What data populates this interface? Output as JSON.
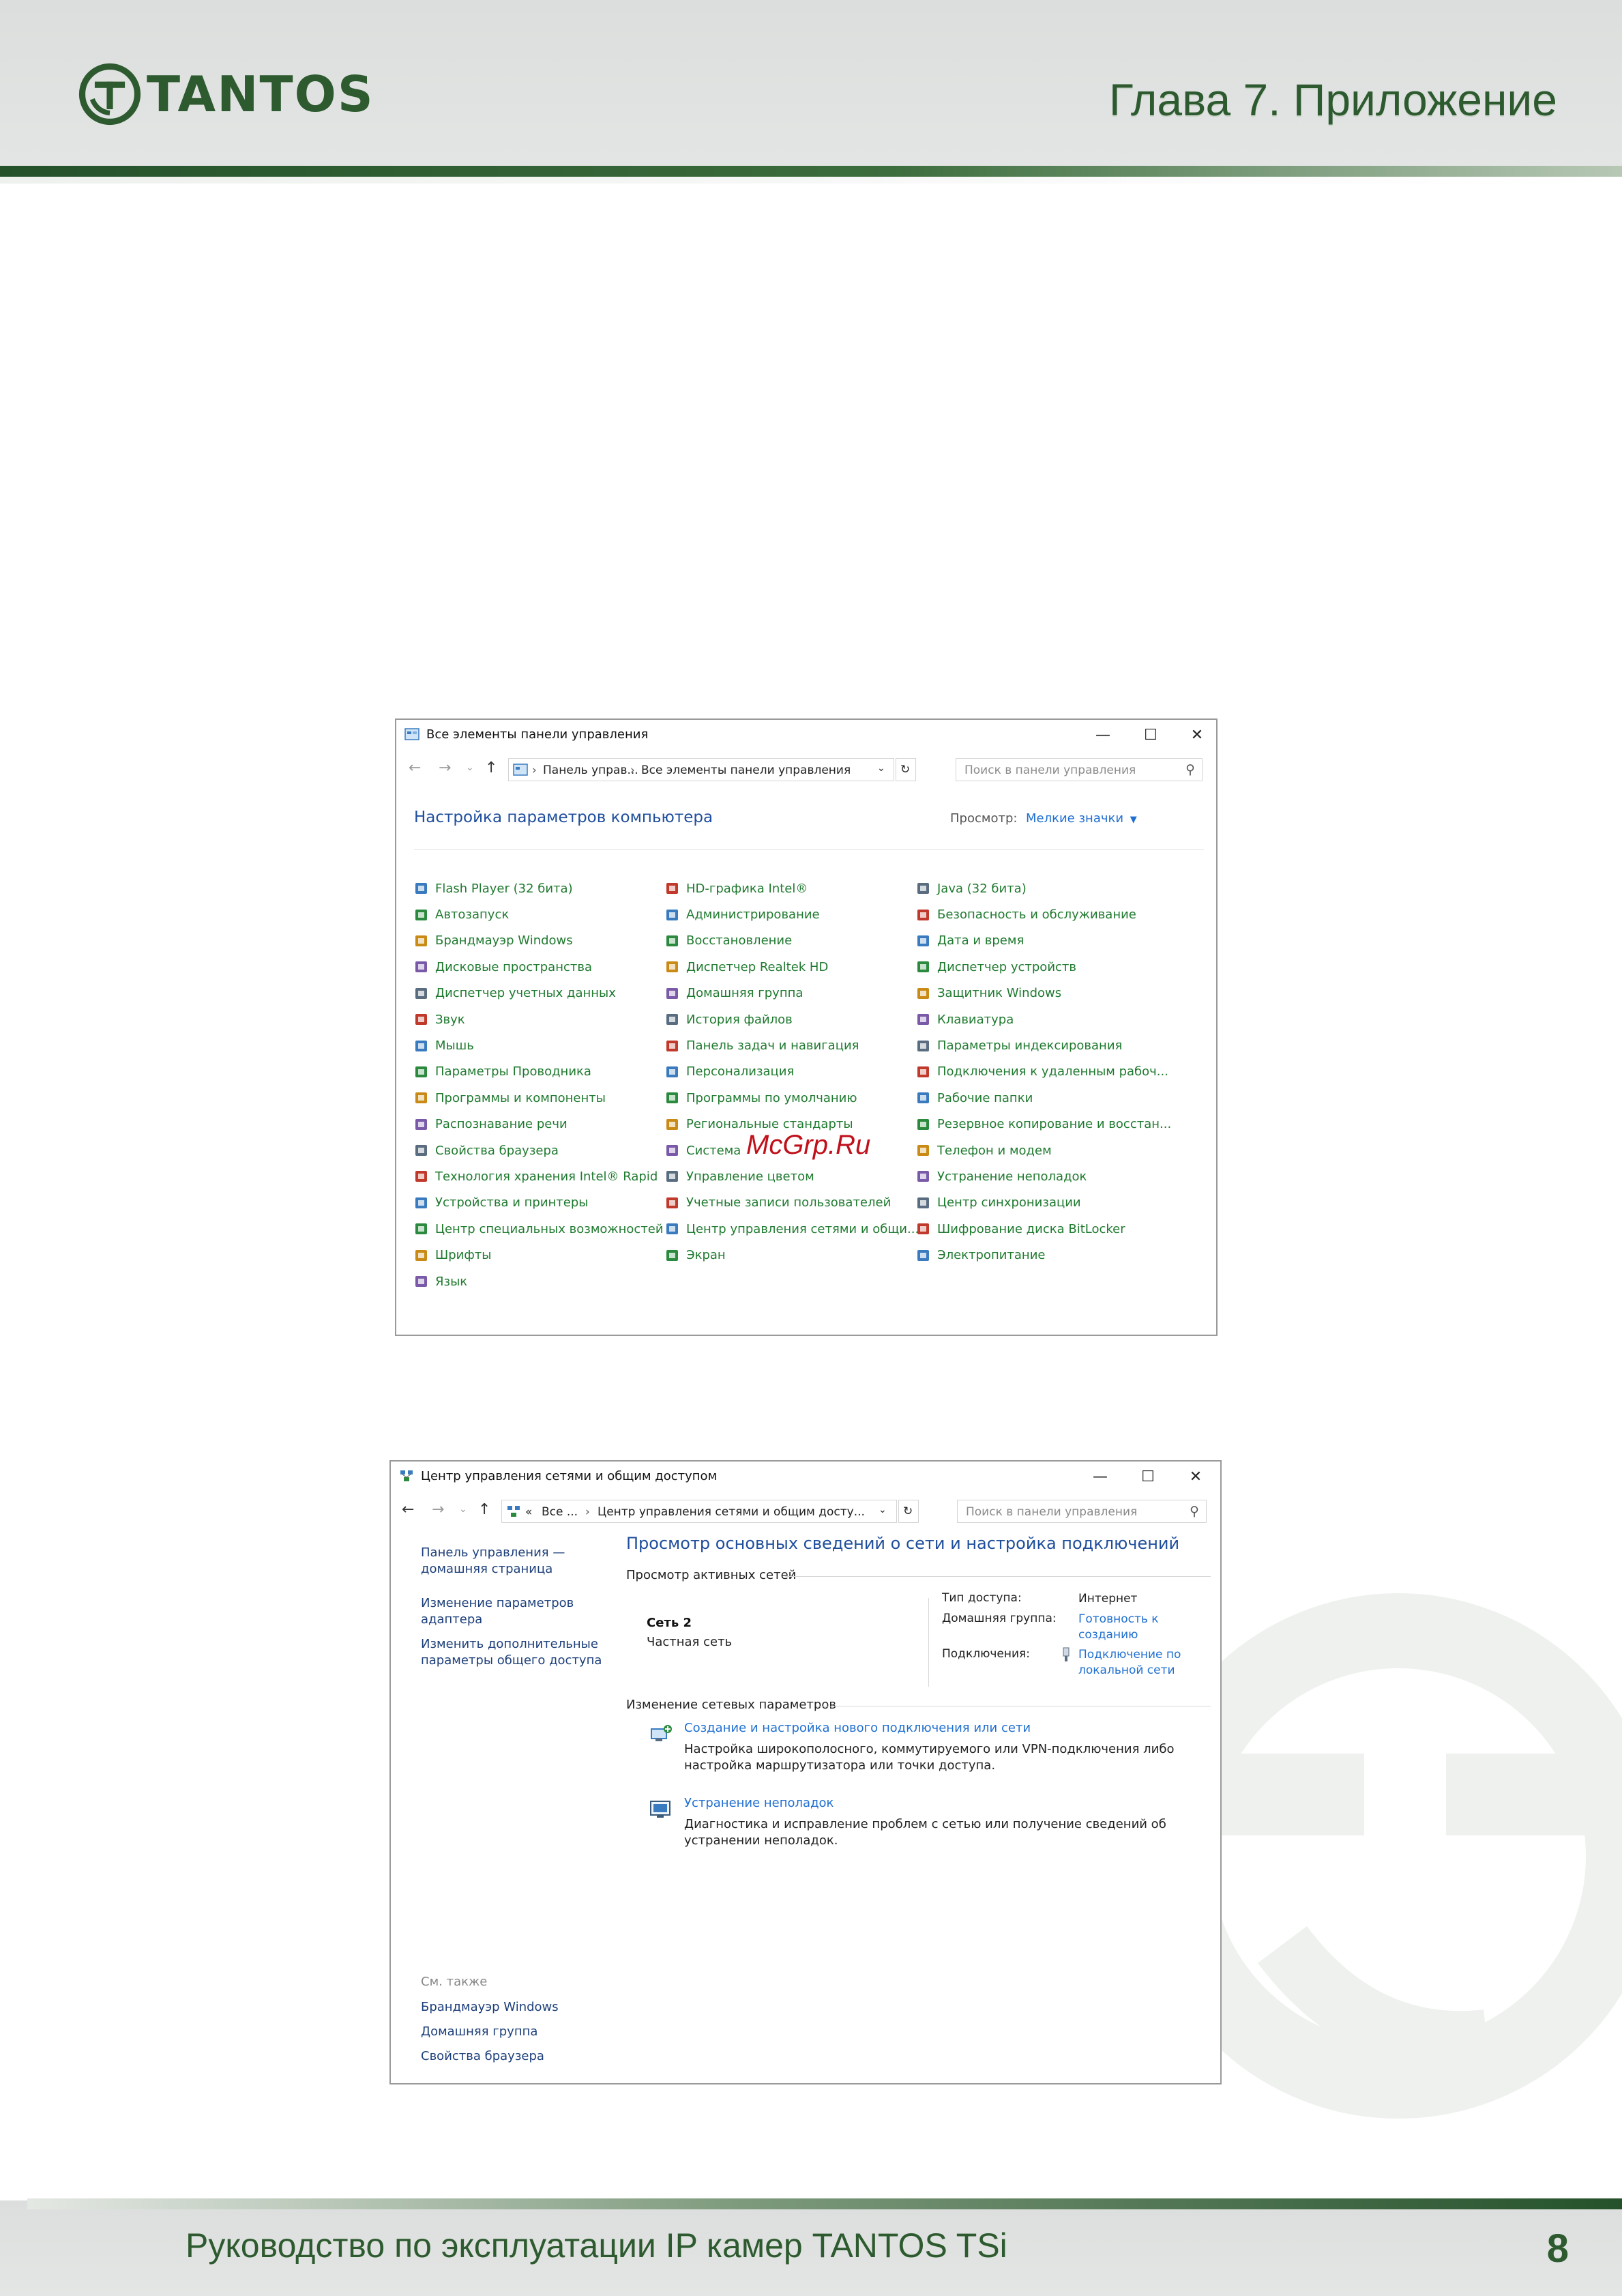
{
  "header": {
    "logo_text": "TANTOS",
    "chapter": "Глава 7. Приложение"
  },
  "footer": {
    "title": "Руководство по эксплуатации IP камер TANTOS TSi",
    "page": "8"
  },
  "watermark": "McGrp.Ru",
  "window1": {
    "title": "Все элементы панели управления",
    "breadcrumb": [
      "Панель управ...",
      "Все элементы панели управления"
    ],
    "search_placeholder": "Поиск в панели управления",
    "heading": "Настройка параметров компьютера",
    "view_label": "Просмотр:",
    "view_value": "Мелкие значки",
    "columns": [
      [
        {
          "label": "Flash Player (32 бита)",
          "icon": "flash-icon"
        },
        {
          "label": "Автозапуск",
          "icon": "autoplay-icon"
        },
        {
          "label": "Брандмауэр Windows",
          "icon": "firewall-icon"
        },
        {
          "label": "Дисковые пространства",
          "icon": "storage-icon"
        },
        {
          "label": "Диспетчер учетных данных",
          "icon": "credential-icon"
        },
        {
          "label": "Звук",
          "icon": "sound-icon"
        },
        {
          "label": "Мышь",
          "icon": "mouse-icon"
        },
        {
          "label": "Параметры Проводника",
          "icon": "folder-options-icon"
        },
        {
          "label": "Программы и компоненты",
          "icon": "programs-icon"
        },
        {
          "label": "Распознавание речи",
          "icon": "microphone-icon"
        },
        {
          "label": "Свойства браузера",
          "icon": "internet-options-icon"
        },
        {
          "label": "Технология хранения Intel® Rapid",
          "icon": "intel-rapid-icon"
        },
        {
          "label": "Устройства и принтеры",
          "icon": "printer-icon"
        },
        {
          "label": "Центр специальных возможностей",
          "icon": "accessibility-icon"
        },
        {
          "label": "Шрифты",
          "icon": "fonts-icon"
        },
        {
          "label": "Язык",
          "icon": "language-icon"
        }
      ],
      [
        {
          "label": "HD-графика Intel®",
          "icon": "intel-graphics-icon"
        },
        {
          "label": "Администрирование",
          "icon": "admin-tools-icon"
        },
        {
          "label": "Восстановление",
          "icon": "recovery-icon"
        },
        {
          "label": "Диспетчер Realtek HD",
          "icon": "realtek-icon"
        },
        {
          "label": "Домашняя группа",
          "icon": "homegroup-icon"
        },
        {
          "label": "История файлов",
          "icon": "file-history-icon"
        },
        {
          "label": "Панель задач и навигация",
          "icon": "taskbar-icon"
        },
        {
          "label": "Персонализация",
          "icon": "personalization-icon"
        },
        {
          "label": "Программы по умолчанию",
          "icon": "default-programs-icon"
        },
        {
          "label": "Региональные стандарты",
          "icon": "region-icon"
        },
        {
          "label": "Система",
          "icon": "system-icon"
        },
        {
          "label": "Управление цветом",
          "icon": "color-management-icon"
        },
        {
          "label": "Учетные записи пользователей",
          "icon": "user-accounts-icon"
        },
        {
          "label": "Центр управления сетями и общи...",
          "icon": "network-center-icon"
        },
        {
          "label": "Экран",
          "icon": "display-icon"
        }
      ],
      [
        {
          "label": "Java (32 бита)",
          "icon": "java-icon"
        },
        {
          "label": "Безопасность и обслуживание",
          "icon": "security-flag-icon"
        },
        {
          "label": "Дата и время",
          "icon": "date-time-icon"
        },
        {
          "label": "Диспетчер устройств",
          "icon": "device-manager-icon"
        },
        {
          "label": "Защитник Windows",
          "icon": "defender-icon"
        },
        {
          "label": "Клавиатура",
          "icon": "keyboard-icon"
        },
        {
          "label": "Параметры индексирования",
          "icon": "indexing-icon"
        },
        {
          "label": "Подключения к удаленным рабоч...",
          "icon": "remote-desktop-icon"
        },
        {
          "label": "Рабочие папки",
          "icon": "work-folders-icon"
        },
        {
          "label": "Резервное копирование и восстан...",
          "icon": "backup-icon"
        },
        {
          "label": "Телефон и модем",
          "icon": "phone-modem-icon"
        },
        {
          "label": "Устранение неполадок",
          "icon": "troubleshoot-icon"
        },
        {
          "label": "Центр синхронизации",
          "icon": "sync-center-icon"
        },
        {
          "label": "Шифрование диска BitLocker",
          "icon": "bitlocker-icon"
        },
        {
          "label": "Электропитание",
          "icon": "power-icon"
        }
      ]
    ]
  },
  "window2": {
    "title": "Центр управления сетями и общим доступом",
    "breadcrumb": [
      "«",
      "Все ...",
      "Центр управления сетями и общим досту..."
    ],
    "search_placeholder": "Поиск в панели управления",
    "sidebar": {
      "home_link": "Панель управления —\nдомашняя страница",
      "adapter_link": "Изменение параметров\nадаптера",
      "sharing_link": "Изменить дополнительные\nпараметры общего доступа",
      "see_also": "См. также",
      "see_also_links": [
        "Брандмауэр Windows",
        "Домашняя группа",
        "Свойства браузера"
      ]
    },
    "heading": "Просмотр основных сведений о сети и настройка подключений",
    "active_networks_label": "Просмотр активных сетей",
    "network": {
      "name": "Сеть  2",
      "type": "Частная сеть",
      "access_type_label": "Тип доступа:",
      "access_type_value": "Интернет",
      "homegroup_label": "Домашняя группа:",
      "homegroup_value": "Готовность к\nсозданию",
      "connections_label": "Подключения:",
      "connections_value": "Подключение по\nлокальной сети"
    },
    "change_settings_label": "Изменение сетевых параметров",
    "tasks": [
      {
        "link": "Создание и настройка нового подключения или сети",
        "desc": "Настройка широкополосного, коммутируемого или VPN-подключения либо настройка маршрутизатора или точки доступа.",
        "icon": "new-connection-icon"
      },
      {
        "link": "Устранение неполадок",
        "desc": "Диагностика и исправление проблем с сетью или получение сведений об устранении неполадок.",
        "icon": "troubleshoot-icon"
      }
    ]
  }
}
